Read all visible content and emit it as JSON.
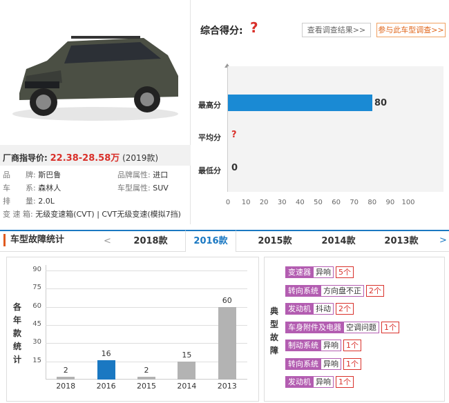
{
  "car": {
    "price_label": "厂商指导价:",
    "price": "22.38-28.58万",
    "year": "(2019款)",
    "specs": [
      {
        "k": "品　　牌:",
        "v": "斯巴鲁",
        "k2": "品牌属性:",
        "v2": "进口"
      },
      {
        "k": "车　　系:",
        "v": "森林人",
        "k2": "车型属性:",
        "v2": "SUV"
      },
      {
        "k": "排　　量:",
        "v": "2.0L"
      },
      {
        "k": "变 速 箱:",
        "v": "无级变速箱(CVT) | CVT无级变速(模拟7挡)"
      }
    ]
  },
  "score": {
    "title": "综合得分:",
    "value": "?",
    "view_button": "查看调查结果>>",
    "join_button": "参与此车型调查>>",
    "rows": [
      {
        "label": "最高分",
        "value": "80",
        "fraction": 0.8
      },
      {
        "label": "平均分",
        "value": "?"
      },
      {
        "label": "最低分",
        "value": "0",
        "fraction": 0
      }
    ],
    "ticks": [
      "0",
      "10",
      "20",
      "30",
      "40",
      "50",
      "60",
      "70",
      "80",
      "90",
      "100"
    ]
  },
  "tabs": {
    "heading": "车型故障统计",
    "prev": "<",
    "next": ">",
    "items": [
      "2018款",
      "2016款",
      "2015款",
      "2014款",
      "2013款"
    ],
    "active": 1
  },
  "chart_data": {
    "type": "bar",
    "ylabel": "各年款统计",
    "categories": [
      "2018",
      "2016",
      "2015",
      "2014",
      "2013"
    ],
    "values": [
      2,
      16,
      2,
      15,
      60
    ],
    "value_labels": [
      "2",
      "16",
      "2",
      "15",
      "60"
    ],
    "highlight_index": 1,
    "highlight_color": "#1a78c2",
    "bar_color": "#b3b3b3",
    "yticks": [
      "90",
      "75",
      "60",
      "45",
      "30",
      "15"
    ],
    "ylim": [
      0,
      90
    ],
    "grid": true
  },
  "faults": {
    "label": "典型故障",
    "items": [
      {
        "cat": "变速器",
        "sym": "异响",
        "cnt": "5个"
      },
      {
        "cat": "转向系统",
        "sym": "方向盘不正",
        "cnt": "2个"
      },
      {
        "cat": "发动机",
        "sym": "抖动",
        "cnt": "2个"
      },
      {
        "cat": "车身附件及电器",
        "sym": "空调问题",
        "cnt": "1个"
      },
      {
        "cat": "制动系统",
        "sym": "异响",
        "cnt": "1个"
      },
      {
        "cat": "转向系统",
        "sym": "异响",
        "cnt": "1个"
      },
      {
        "cat": "发动机",
        "sym": "异响",
        "cnt": "1个"
      }
    ],
    "accent": "#b35db1"
  }
}
